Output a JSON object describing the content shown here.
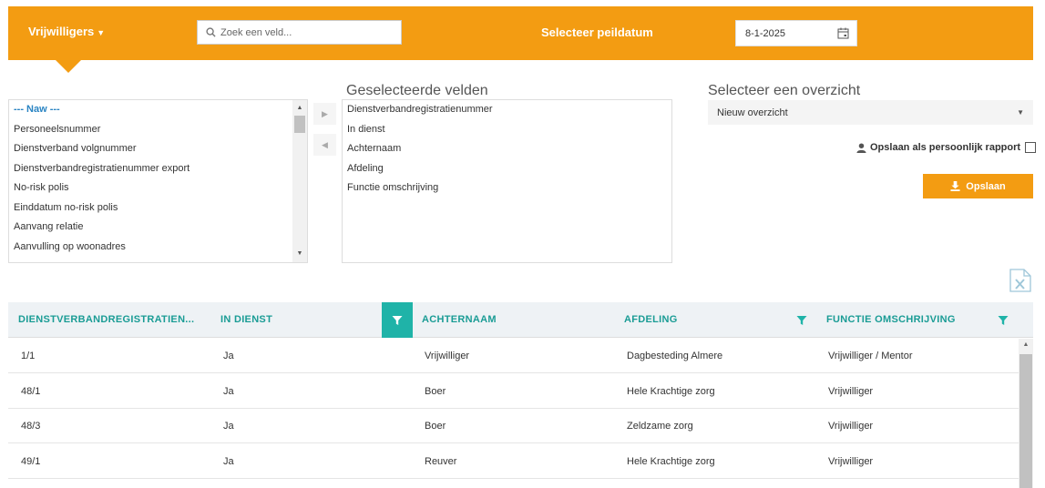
{
  "header": {
    "module": "Vrijwilligers",
    "search_placeholder": "Zoek een veld...",
    "peildatum_label": "Selecteer peildatum",
    "peildatum_value": "8-1-2025",
    "accent_color": "#f39c12"
  },
  "available_fields": [
    {
      "label": "--- Naw ---",
      "group": true
    },
    {
      "label": "Personeelsnummer",
      "group": false
    },
    {
      "label": "Dienstverband volgnummer",
      "group": false
    },
    {
      "label": "Dienstverbandregistratienummer export",
      "group": false
    },
    {
      "label": "No-risk polis",
      "group": false
    },
    {
      "label": "Einddatum no-risk polis",
      "group": false
    },
    {
      "label": "Aanvang relatie",
      "group": false
    },
    {
      "label": "Aanvulling op woonadres",
      "group": false
    }
  ],
  "selected": {
    "title": "Geselecteerde velden",
    "fields": [
      "Dienstverbandregistratienummer",
      "In dienst",
      "Achternaam",
      "Afdeling",
      "Functie omschrijving"
    ]
  },
  "overview": {
    "title": "Selecteer een overzicht",
    "selected_option": "Nieuw overzicht",
    "personal_label": "Opslaan als persoonlijk rapport",
    "save_label": "Opslaan"
  },
  "table": {
    "filter_color": "#1fb3a8",
    "header_color": "#1a9c95",
    "columns": [
      "DIENSTVERBANDREGISTRATIEN...",
      "IN DIENST",
      "ACHTERNAAM",
      "AFDELING",
      "FUNCTIE OMSCHRIJVING"
    ],
    "rows": [
      [
        "1/1",
        "Ja",
        "Vrijwilliger",
        "Dagbesteding Almere",
        "Vrijwilliger / Mentor"
      ],
      [
        "48/1",
        "Ja",
        "Boer",
        "Hele Krachtige zorg",
        "Vrijwilliger"
      ],
      [
        "48/3",
        "Ja",
        "Boer",
        "Zeldzame zorg",
        "Vrijwilliger"
      ],
      [
        "49/1",
        "Ja",
        "Reuver",
        "Hele Krachtige zorg",
        "Vrijwilliger"
      ]
    ]
  }
}
